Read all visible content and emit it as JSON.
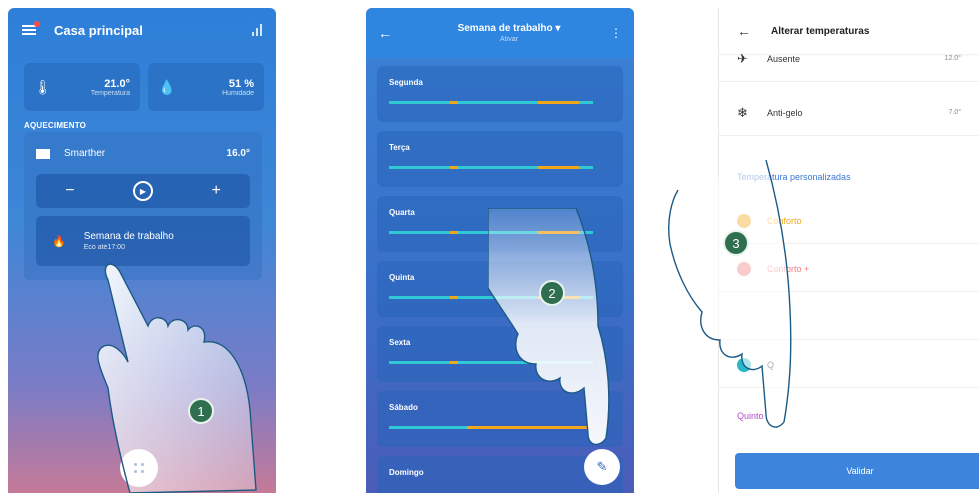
{
  "screen1": {
    "title": "Casa principal",
    "temperature": {
      "value": "21.0°",
      "label": "Temperatura"
    },
    "humidity": {
      "value": "51 %",
      "label": "Humidade"
    },
    "section": "AQUECIMENTO",
    "device": {
      "name": "Smarther",
      "temp": "16.0°"
    },
    "controls": {
      "minus": "−",
      "plus": "+"
    },
    "program": {
      "name": "Semana de trabalho",
      "status": "Eco até17:00"
    }
  },
  "screen2": {
    "title": "Semana de trabalho",
    "subtitle": "Ativar",
    "days": [
      "Segunda",
      "Terça",
      "Quarta",
      "Quinta",
      "Sexta",
      "Sábado",
      "Domingo"
    ]
  },
  "screen3": {
    "title": "Alterar temperaturas",
    "absent": {
      "name": "Ausente",
      "value": "12.0°"
    },
    "antifreeze": {
      "name": "Anti-gelo",
      "value": "7.0°"
    },
    "section": "Temperatura personalizadas",
    "comfort": "Conforto",
    "comfort_plus": "Conforto +",
    "night_label": "Q",
    "custom": "Quinto",
    "validate": "Validar"
  },
  "markers": [
    "1",
    "2",
    "3"
  ],
  "colors": {
    "accent": "#3d84dd",
    "comfort": "#f2a71b",
    "schedule_bar": "#2fc9d6"
  }
}
